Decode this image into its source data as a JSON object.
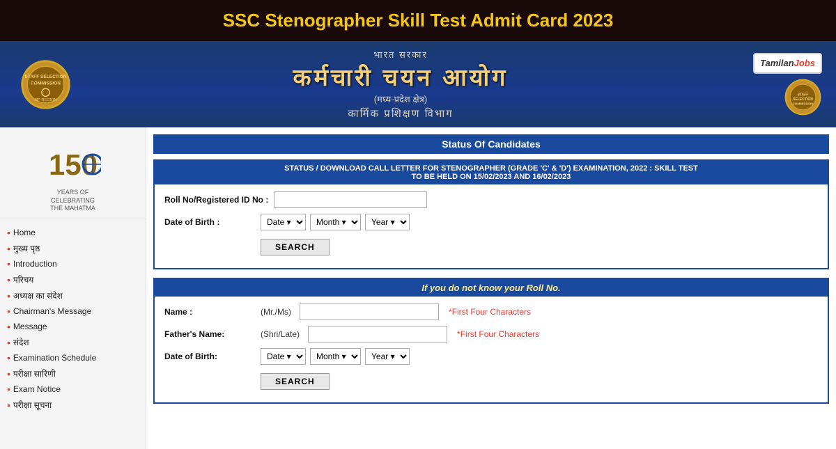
{
  "page": {
    "title": "SSC Stenographer Skill Test Admit Card 2023",
    "background_color": "#1a0a0a",
    "title_color": "#f5c518"
  },
  "header": {
    "hindi_top": "भारत सरकार",
    "hindi_main": "कर्मचारी चयन आयोग",
    "hindi_sub": "(मध्य-प्रदेश क्षेत्र)",
    "hindi_dept": "कार्मिक प्रशिक्षण विभाग",
    "logo_alt": "SSC Emblem",
    "tamilan_jobs_label": "TamilanJobs"
  },
  "sidebar": {
    "gandhi_years": "150",
    "gandhi_subtitle": "YEARS OF\nCELEBRATING\nTHE MAHATMA",
    "nav_items": [
      {
        "label": "Home"
      },
      {
        "label": "मुख्य पृष्ठ"
      },
      {
        "label": "Introduction"
      },
      {
        "label": "परिचय"
      },
      {
        "label": "अध्यक्ष का संदेश"
      },
      {
        "label": "Chairman's Message"
      },
      {
        "label": "Message"
      },
      {
        "label": "संदेश"
      },
      {
        "label": "Examination Schedule"
      },
      {
        "label": "परीक्षा सारिणी"
      },
      {
        "label": "Exam Notice"
      },
      {
        "label": "परीक्षा सूचना"
      }
    ]
  },
  "main": {
    "status_header": "Status Of Candidates",
    "form1": {
      "banner_line1": "STATUS / DOWNLOAD CALL LETTER FOR STENOGRAPHER (GRADE 'C' & 'D') EXAMINATION, 2022 : SKILL TEST",
      "banner_line2": "TO BE HELD ON 15/02/2023 AND 16/02/2023",
      "roll_no_label": "Roll No/Registered ID No :",
      "roll_no_placeholder": "",
      "dob_label": "Date of Birth :",
      "date_options": [
        "Date"
      ],
      "month_options": [
        "Month"
      ],
      "year_options": [
        "Year"
      ],
      "search_button": "SEARCH"
    },
    "form2": {
      "roll_header": "If you do not know your Roll No.",
      "name_label": "Name :",
      "name_prefix": "(Mr./Ms)",
      "name_hint": "*First Four Characters",
      "father_label": "Father's Name:",
      "father_prefix": "(Shri/Late)",
      "father_hint": "*First Four Characters",
      "dob_label": "Date of Birth:",
      "date_options": [
        "Date"
      ],
      "month_options": [
        "Month"
      ],
      "year_options": [
        "Year"
      ],
      "search_button": "SEARCH"
    }
  }
}
